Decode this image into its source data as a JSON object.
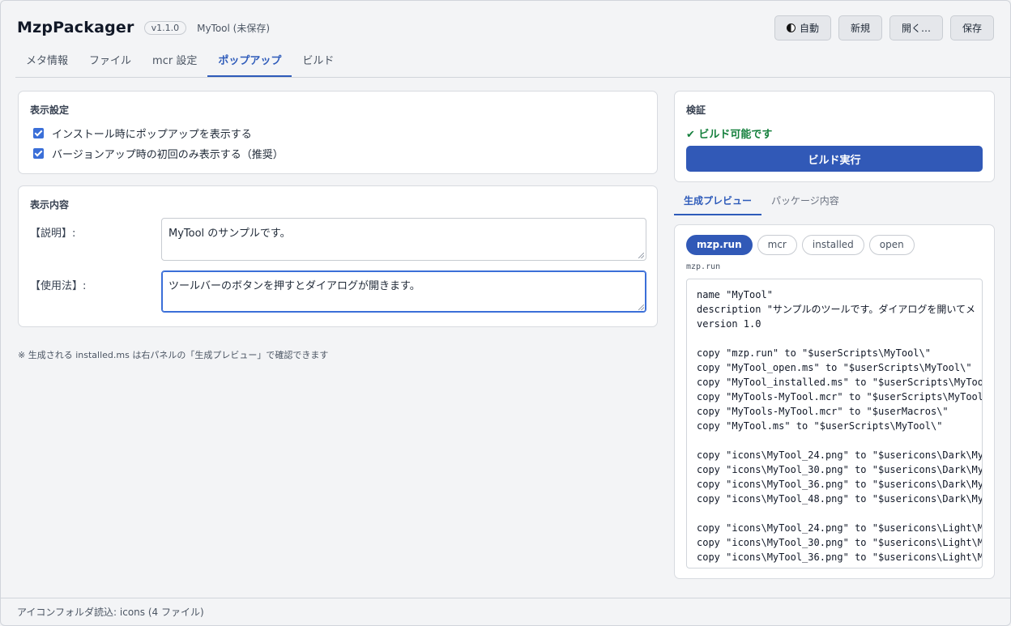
{
  "app": {
    "title": "MzpPackager",
    "version": "v1.1.0",
    "project": "MyTool (未保存)"
  },
  "toolbar": {
    "theme_label": "自動",
    "new_label": "新規",
    "open_label": "開く…",
    "save_label": "保存"
  },
  "tabs": [
    "メタ情報",
    "ファイル",
    "mcr 設定",
    "ポップアップ",
    "ビルド"
  ],
  "active_tab": "ポップアップ",
  "display_settings": {
    "title": "表示設定",
    "options": [
      {
        "label": "インストール時にポップアップを表示する",
        "checked": true
      },
      {
        "label": "バージョンアップ時の初回のみ表示する（推奨）",
        "checked": true
      }
    ]
  },
  "display_content": {
    "title": "表示内容",
    "description_label": "【説明】:",
    "description_value": "MyTool のサンプルです。",
    "usage_label": "【使用法】:",
    "usage_value": "ツールバーのボタンを押すとダイアログが開きます。"
  },
  "note": "※ 生成される installed.ms は右パネルの「生成プレビュー」で確認できます",
  "validation": {
    "title": "検証",
    "status": "✔ ビルド可能です",
    "build_label": "ビルド実行"
  },
  "preview": {
    "tabs": [
      "生成プレビュー",
      "パッケージ内容"
    ],
    "active_tab": "生成プレビュー",
    "files": [
      "mzp.run",
      "mcr",
      "installed",
      "open"
    ],
    "active_file": "mzp.run",
    "file_label": "mzp.run",
    "code": "name \"MyTool\"\ndescription \"サンプルのツールです。ダイアログを開いてメ\nversion 1.0\n\ncopy \"mzp.run\" to \"$userScripts\\MyTool\\\"\ncopy \"MyTool_open.ms\" to \"$userScripts\\MyTool\\\"\ncopy \"MyTool_installed.ms\" to \"$userScripts\\MyToo\ncopy \"MyTools-MyTool.mcr\" to \"$userScripts\\MyTool\ncopy \"MyTools-MyTool.mcr\" to \"$userMacros\\\"\ncopy \"MyTool.ms\" to \"$userScripts\\MyTool\\\"\n\ncopy \"icons\\MyTool_24.png\" to \"$usericons\\Dark\\My\ncopy \"icons\\MyTool_30.png\" to \"$usericons\\Dark\\My\ncopy \"icons\\MyTool_36.png\" to \"$usericons\\Dark\\My\ncopy \"icons\\MyTool_48.png\" to \"$usericons\\Dark\\My\n\ncopy \"icons\\MyTool_24.png\" to \"$usericons\\Light\\M\ncopy \"icons\\MyTool_30.png\" to \"$usericons\\Light\\M\ncopy \"icons\\MyTool_36.png\" to \"$usericons\\Light\\M"
  },
  "status_bar": "アイコンフォルダ読込: icons (4 ファイル)"
}
